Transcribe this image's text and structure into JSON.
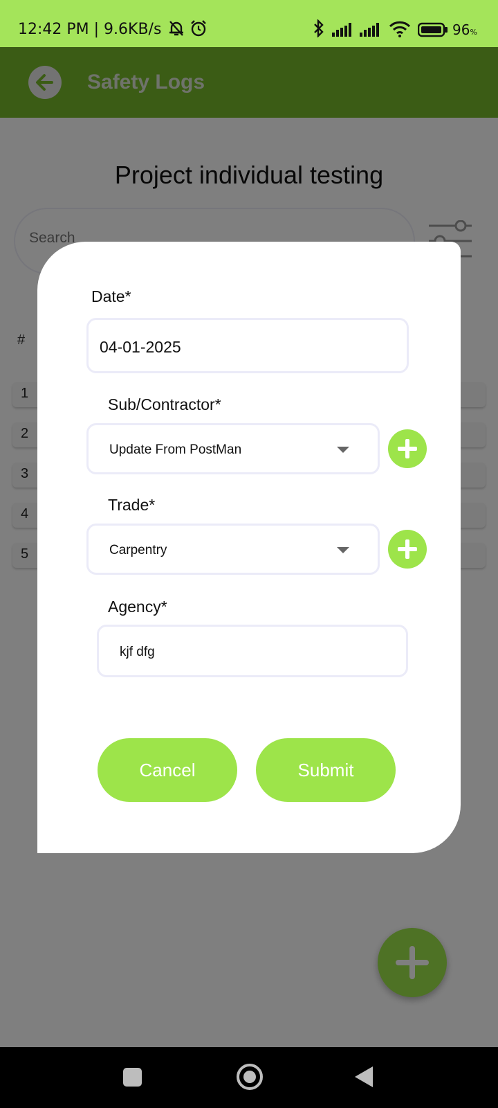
{
  "status_bar": {
    "time": "12:42 PM | 9.6KB/s",
    "battery_percent": "96",
    "battery_unit": "%",
    "icons": [
      "bell-off-icon",
      "alarm-icon",
      "bluetooth-icon",
      "signal-icon",
      "signal-icon",
      "wifi-icon",
      "battery-icon"
    ]
  },
  "app_bar": {
    "title": "Safety Logs",
    "back_icon": "arrow-left-icon"
  },
  "page": {
    "project_title": "Project individual testing",
    "search_placeholder": "Search",
    "table_header_index": "#",
    "rows": [
      "1",
      "2",
      "3",
      "4",
      "5"
    ],
    "fab_icon": "plus-icon"
  },
  "dialog": {
    "date_label": "Date*",
    "date_value": "04-01-2025",
    "subcontractor_label": "Sub/Contractor*",
    "subcontractor_value": "Update From PostMan",
    "trade_label": "Trade*",
    "trade_value": "Carpentry",
    "agency_label": "Agency*",
    "agency_value": "kjf dfg",
    "cancel_label": "Cancel",
    "submit_label": "Submit"
  },
  "colors": {
    "accent": "#9de44a",
    "app_bar": "#76b82a",
    "status_bar": "#a4e45a"
  }
}
